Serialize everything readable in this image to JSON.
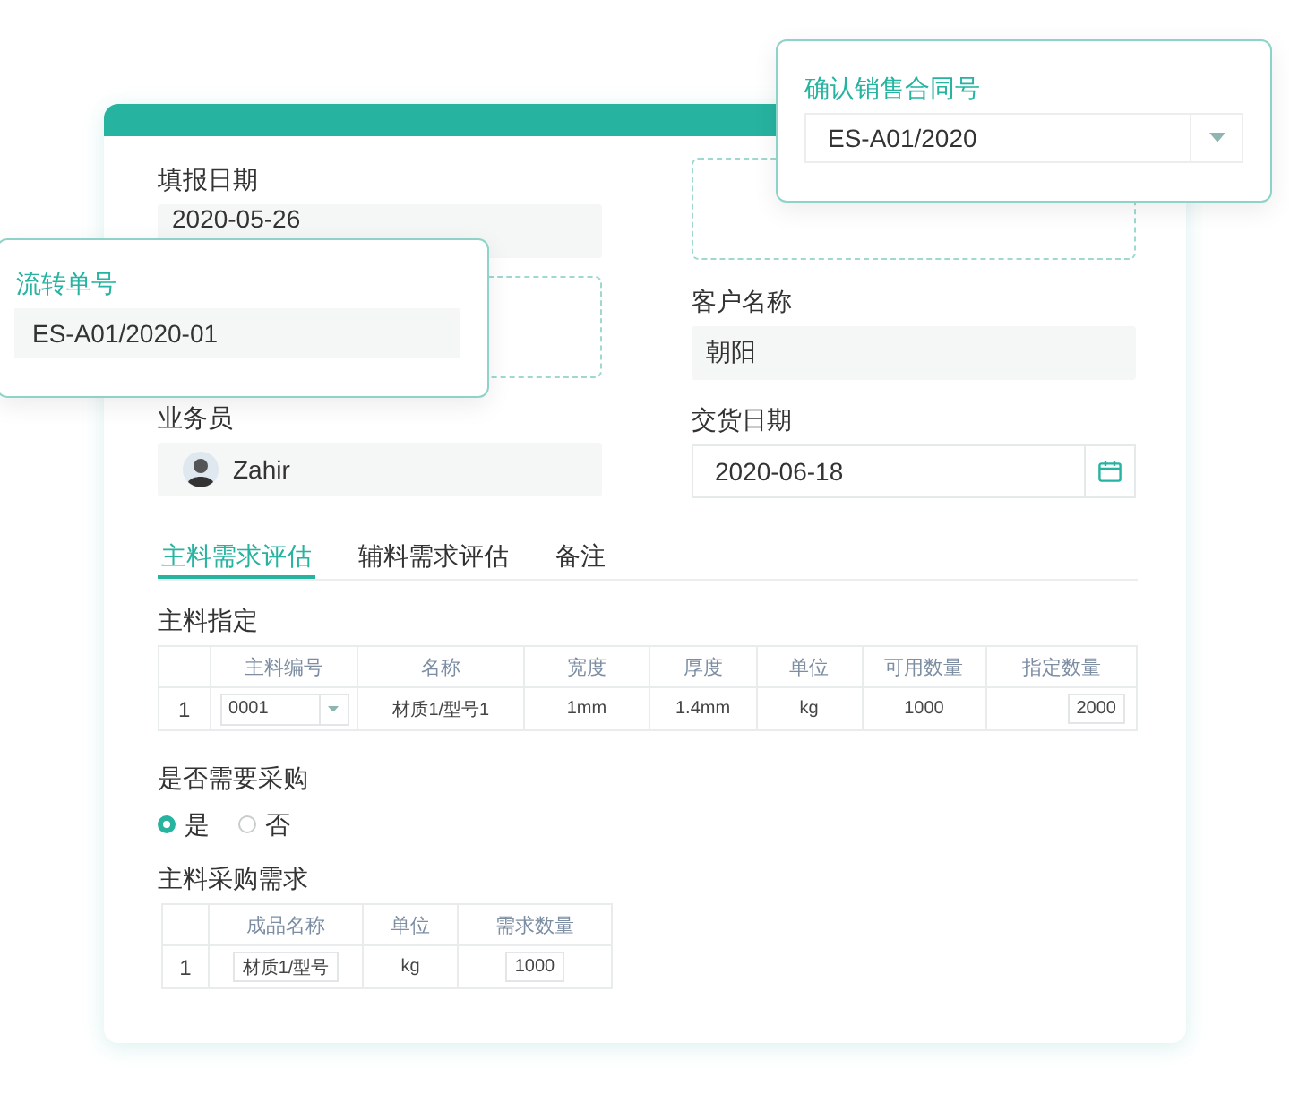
{
  "left_column": [
    {
      "kind": "field",
      "label": "填报日期",
      "value": "2020-05-26"
    },
    {
      "kind": "empty_slot"
    },
    {
      "kind": "user",
      "label": "业务员",
      "value": "Zahir"
    }
  ],
  "right_column": [
    {
      "kind": "empty_slot"
    },
    {
      "kind": "field",
      "label": "客户名称",
      "value": "朝阳"
    },
    {
      "kind": "date",
      "label": "交货日期",
      "value": "2020-06-18"
    }
  ],
  "tabs": [
    {
      "label": "主料需求评估",
      "selected": true
    },
    {
      "label": "辅料需求评估",
      "selected": false
    },
    {
      "label": "备注",
      "selected": false
    }
  ],
  "material_section": {
    "title": "主料指定",
    "table": {
      "columns": [
        "主料编号",
        "名称",
        "宽度",
        "厚度",
        "单位",
        "可用数量",
        "指定数量"
      ],
      "rows": [
        {
          "index": "1",
          "cells": [
            {
              "kind": "dropdown",
              "value": "0001"
            },
            {
              "kind": "text",
              "value": "材质1/型号1"
            },
            {
              "kind": "text",
              "value": "1mm"
            },
            {
              "kind": "text",
              "value": "1.4mm"
            },
            {
              "kind": "text",
              "value": "kg"
            },
            {
              "kind": "text",
              "value": "1000"
            },
            {
              "kind": "input",
              "value": "2000"
            }
          ]
        }
      ]
    }
  },
  "purchase_question": {
    "label": "是否需要采购",
    "options": [
      {
        "label": "是",
        "selected": true
      },
      {
        "label": "否",
        "selected": false
      }
    ]
  },
  "purchase_section": {
    "title": "主料采购需求",
    "table": {
      "columns": [
        "成品名称",
        "单位",
        "需求数量"
      ],
      "rows": [
        {
          "index": "1",
          "cells": [
            {
              "kind": "input",
              "value": "材质1/型号"
            },
            {
              "kind": "text",
              "value": "kg"
            },
            {
              "kind": "input",
              "value": "1000"
            }
          ]
        }
      ]
    }
  },
  "popups": [
    {
      "kind": "text",
      "title": "流转单号",
      "value": "ES-A01/2020-01"
    },
    {
      "kind": "dropdown",
      "title": "确认销售合同号",
      "value": "ES-A01/2020"
    }
  ]
}
